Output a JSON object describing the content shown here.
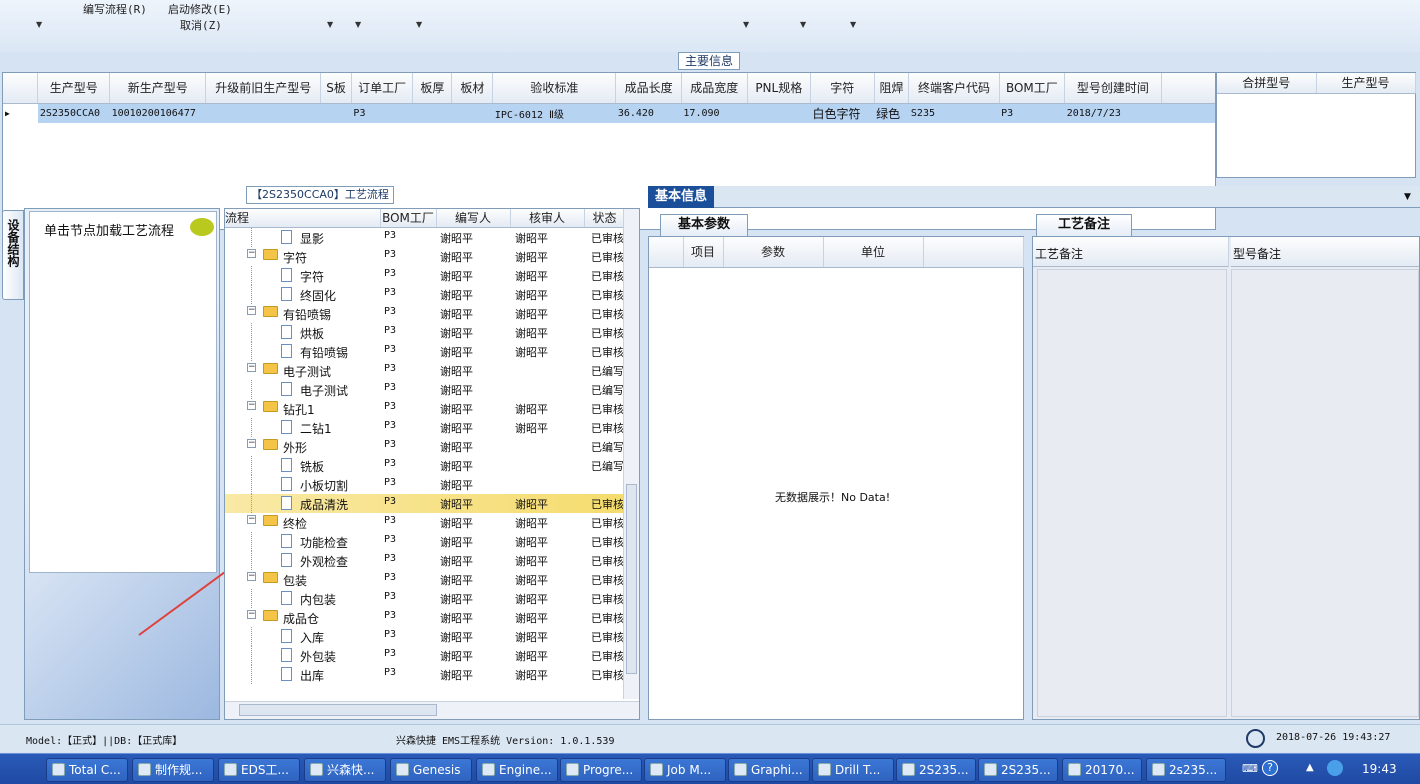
{
  "menu": {
    "items": [
      "编写流程(R)",
      "启动修改(E)",
      "取消(Z)"
    ]
  },
  "main_info": {
    "title": "主要信息",
    "columns": [
      "生产型号",
      "新生产型号",
      "升级前旧生产型号",
      "S板",
      "订单工厂",
      "板厚",
      "板材",
      "验收标准",
      "成品长度",
      "成品宽度",
      "PNL规格",
      "字符",
      "阻焊",
      "终端客户代码",
      "BOM工厂",
      "型号创建时间"
    ],
    "row": [
      "2S2350CCA0",
      "10010200106477",
      "",
      "",
      "P3",
      "",
      "",
      "IPC-6012 Ⅱ级",
      "36.420",
      "17.090",
      "",
      "白色字符",
      "绿色",
      "S235",
      "P3",
      "2018/7/23"
    ],
    "side_columns": [
      "合拼型号",
      "生产型号"
    ]
  },
  "left_panel": {
    "vertical_tab": "设备结构",
    "hint": "单击节点加载工艺流程"
  },
  "flow": {
    "title": "【2S2350CCA0】工艺流程",
    "columns": [
      "流程",
      "BOM工厂",
      "编写人",
      "核审人",
      "状态"
    ],
    "rows": [
      {
        "name": "显影",
        "level": 1,
        "bom": "P3",
        "writer": "谢昭平",
        "reviewer": "谢昭平",
        "status": "已审核"
      },
      {
        "name": "字符",
        "level": 0,
        "bom": "P3",
        "writer": "谢昭平",
        "reviewer": "谢昭平",
        "status": "已审核"
      },
      {
        "name": "字符",
        "level": 1,
        "bom": "P3",
        "writer": "谢昭平",
        "reviewer": "谢昭平",
        "status": "已审核"
      },
      {
        "name": "终固化",
        "level": 1,
        "bom": "P3",
        "writer": "谢昭平",
        "reviewer": "谢昭平",
        "status": "已审核"
      },
      {
        "name": "有铅喷锡",
        "level": 0,
        "bom": "P3",
        "writer": "谢昭平",
        "reviewer": "谢昭平",
        "status": "已审核"
      },
      {
        "name": "烘板",
        "level": 1,
        "bom": "P3",
        "writer": "谢昭平",
        "reviewer": "谢昭平",
        "status": "已审核"
      },
      {
        "name": "有铅喷锡",
        "level": 1,
        "bom": "P3",
        "writer": "谢昭平",
        "reviewer": "谢昭平",
        "status": "已审核"
      },
      {
        "name": "电子测试",
        "level": 0,
        "bom": "P3",
        "writer": "谢昭平",
        "reviewer": "",
        "status": "已编写"
      },
      {
        "name": "电子测试",
        "level": 1,
        "bom": "P3",
        "writer": "谢昭平",
        "reviewer": "",
        "status": "已编写"
      },
      {
        "name": "钻孔1",
        "level": 0,
        "bom": "P3",
        "writer": "谢昭平",
        "reviewer": "谢昭平",
        "status": "已审核"
      },
      {
        "name": "二钻1",
        "level": 1,
        "bom": "P3",
        "writer": "谢昭平",
        "reviewer": "谢昭平",
        "status": "已审核"
      },
      {
        "name": "外形",
        "level": 0,
        "bom": "P3",
        "writer": "谢昭平",
        "reviewer": "",
        "status": "已编写"
      },
      {
        "name": "铣板",
        "level": 1,
        "bom": "P3",
        "writer": "谢昭平",
        "reviewer": "",
        "status": "已编写"
      },
      {
        "name": "小板切割",
        "level": 1,
        "bom": "P3",
        "writer": "谢昭平",
        "reviewer": "",
        "status": ""
      },
      {
        "name": "成品清洗",
        "level": 1,
        "bom": "P3",
        "writer": "谢昭平",
        "reviewer": "谢昭平",
        "status": "已审核",
        "selected": true
      },
      {
        "name": "终检",
        "level": 0,
        "bom": "P3",
        "writer": "谢昭平",
        "reviewer": "谢昭平",
        "status": "已审核"
      },
      {
        "name": "功能检查",
        "level": 1,
        "bom": "P3",
        "writer": "谢昭平",
        "reviewer": "谢昭平",
        "status": "已审核"
      },
      {
        "name": "外观检查",
        "level": 1,
        "bom": "P3",
        "writer": "谢昭平",
        "reviewer": "谢昭平",
        "status": "已审核"
      },
      {
        "name": "包装",
        "level": 0,
        "bom": "P3",
        "writer": "谢昭平",
        "reviewer": "谢昭平",
        "status": "已审核"
      },
      {
        "name": "内包装",
        "level": 1,
        "bom": "P3",
        "writer": "谢昭平",
        "reviewer": "谢昭平",
        "status": "已审核"
      },
      {
        "name": "成品仓",
        "level": 0,
        "bom": "P3",
        "writer": "谢昭平",
        "reviewer": "谢昭平",
        "status": "已审核"
      },
      {
        "name": "入库",
        "level": 1,
        "bom": "P3",
        "writer": "谢昭平",
        "reviewer": "谢昭平",
        "status": "已审核"
      },
      {
        "name": "外包装",
        "level": 1,
        "bom": "P3",
        "writer": "谢昭平",
        "reviewer": "谢昭平",
        "status": "已审核"
      },
      {
        "name": "出库",
        "level": 1,
        "bom": "P3",
        "writer": "谢昭平",
        "reviewer": "谢昭平",
        "status": "已审核"
      }
    ]
  },
  "basic_info": {
    "header_tab": "基本信息",
    "params_tab": "基本参数",
    "params_columns": [
      "项目",
      "参数",
      "单位"
    ],
    "empty_text": "无数据展示！No Data!",
    "notes_tab": "工艺备注",
    "notes_columns": [
      "工艺备注",
      "型号备注"
    ]
  },
  "status_bar": {
    "env": "Model:【正式】||DB:【正式库】",
    "app": "兴森快捷 EMS工程系统 Version: 1.0.1.539",
    "datetime": "2018-07-26 19:43:27"
  },
  "taskbar": {
    "items": [
      "Total C...",
      "制作规...",
      "EDS工...",
      "兴森快...",
      "Genesis",
      "Engine...",
      "Progre...",
      "Job M...",
      "Graphi...",
      "Drill T...",
      "2S235...",
      "2S235...",
      "20170...",
      "2s235..."
    ],
    "clock": "19:43"
  },
  "colors": {
    "selected_row": "#b7d3f2",
    "highlight_row": "#f5dc6e",
    "taskbar": "#2a5ab8",
    "annotation_arrow": "#e0403a"
  }
}
